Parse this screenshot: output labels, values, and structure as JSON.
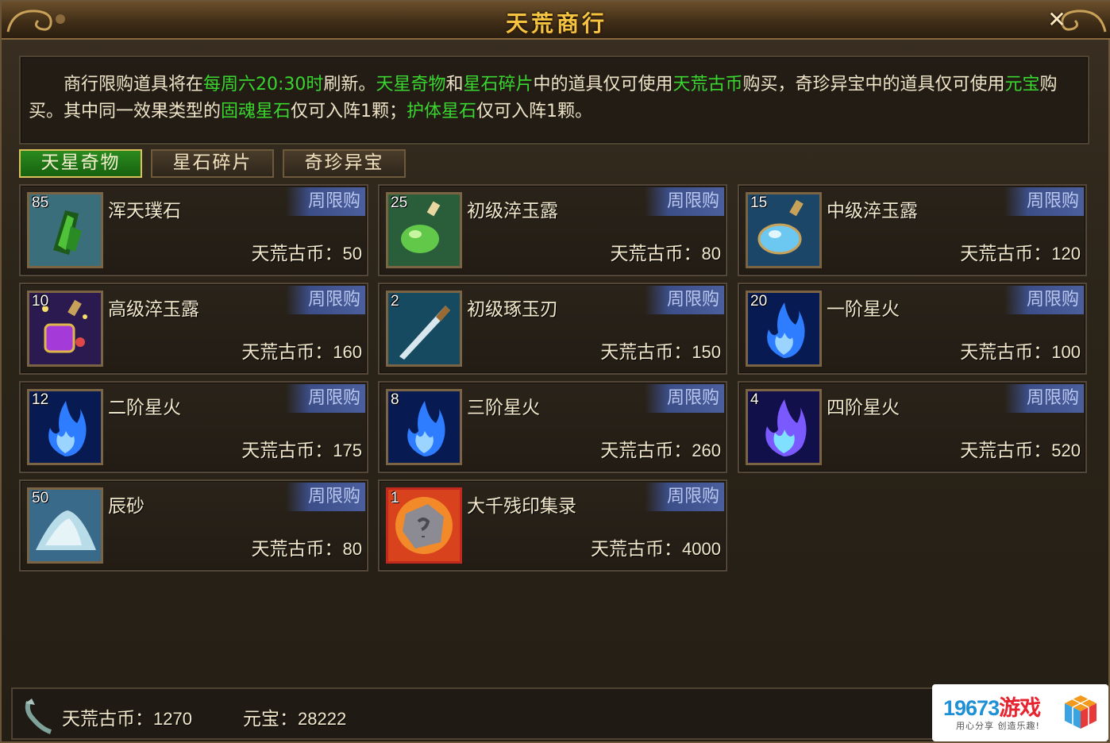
{
  "window": {
    "title": "天荒商行",
    "close_label": "✕"
  },
  "notice": {
    "p1": "商行限购道具将在",
    "h1": "每周六20:30时",
    "p2": "刷新。",
    "h2": "天星奇物",
    "p3": "和",
    "h3": "星石碎片",
    "p4": "中的道具仅可使用",
    "h4": "天荒古币",
    "p5": "购买，奇珍异宝中的道具仅可使用",
    "h5": "元宝",
    "p6": "购买。其中同一效果类型的",
    "h6": "固魂星石",
    "p7": "仅可入阵1颗；",
    "h7": "护体星石",
    "p8": "仅可入阵1颗。"
  },
  "tabs": [
    {
      "label": "天星奇物",
      "active": true
    },
    {
      "label": "星石碎片",
      "active": false
    },
    {
      "label": "奇珍异宝",
      "active": false
    }
  ],
  "currency_label": "天荒古币：",
  "limit_label": "周限购",
  "items": [
    {
      "name": "浑天璞石",
      "qty": "85",
      "price": "50",
      "icon": "green-stone-icon"
    },
    {
      "name": "初级淬玉露",
      "qty": "25",
      "price": "80",
      "icon": "green-potion-icon"
    },
    {
      "name": "中级淬玉露",
      "qty": "15",
      "price": "120",
      "icon": "blue-potion-icon"
    },
    {
      "name": "高级淬玉露",
      "qty": "10",
      "price": "160",
      "icon": "purple-potion-icon"
    },
    {
      "name": "初级琢玉刃",
      "qty": "2",
      "price": "150",
      "icon": "blade-icon"
    },
    {
      "name": "一阶星火",
      "qty": "20",
      "price": "100",
      "icon": "blue-flame-icon"
    },
    {
      "name": "二阶星火",
      "qty": "12",
      "price": "175",
      "icon": "blue-flame-icon"
    },
    {
      "name": "三阶星火",
      "qty": "8",
      "price": "260",
      "icon": "blue-flame-icon"
    },
    {
      "name": "四阶星火",
      "qty": "4",
      "price": "520",
      "icon": "purple-flame-icon"
    },
    {
      "name": "辰砂",
      "qty": "50",
      "price": "80",
      "icon": "sand-pile-icon"
    },
    {
      "name": "大千残印集录",
      "qty": "1",
      "price": "4000",
      "icon": "stone-seal-icon"
    }
  ],
  "footer": {
    "coin_label": "天荒古币：",
    "coin_value": "1270",
    "yuanbao_label": "元宝：",
    "yuanbao_value": "28222"
  },
  "watermark": {
    "num": "19673",
    "cn": "游戏",
    "slogan": "用心分享 创造乐趣!"
  },
  "colors": {
    "highlight": "#39d62f",
    "title": "#f5c542",
    "limit_badge": "#4b5f9e",
    "active_tab": "#2b8a1e"
  }
}
